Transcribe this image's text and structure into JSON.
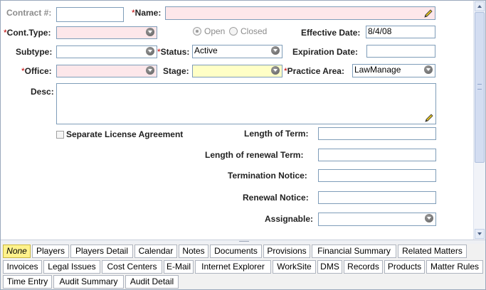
{
  "form": {
    "contract_label": "Contract #:",
    "contract_value": "",
    "name_label": "Name:",
    "name_value": "",
    "conttype_label": "Cont.Type:",
    "conttype_value": "",
    "open_label": "Open",
    "closed_label": "Closed",
    "effective_date_label": "Effective Date:",
    "effective_date_value": "8/4/08",
    "subtype_label": "Subtype:",
    "subtype_value": "",
    "status_label": "Status:",
    "status_value": "Active",
    "expiration_date_label": "Expiration Date:",
    "expiration_date_value": "",
    "office_label": "Office:",
    "office_value": "",
    "stage_label": "Stage:",
    "stage_value": "",
    "practice_area_label": "Practice Area:",
    "practice_area_value": "LawManage",
    "desc_label": "Desc:",
    "desc_value": "",
    "separate_license_label": "Separate License Agreement",
    "length_of_term_label": "Length of Term:",
    "length_of_term_value": "",
    "length_of_renewal_term_label": "Length of renewal Term:",
    "length_of_renewal_term_value": "",
    "termination_notice_label": "Termination Notice:",
    "termination_notice_value": "",
    "renewal_notice_label": "Renewal Notice:",
    "renewal_notice_value": "",
    "assignable_label": "Assignable:",
    "assignable_value": "",
    "required_marker": "*"
  },
  "tabs": {
    "row1": [
      "None",
      "Players",
      "Players Detail",
      "Calendar",
      "Notes",
      "Documents",
      "Provisions",
      "Financial Summary",
      "Related Matters"
    ],
    "row2": [
      "Invoices",
      "Legal Issues",
      "Cost Centers",
      "E-Mail",
      "Internet Explorer",
      "WorkSite",
      "DMS",
      "Records",
      "Products",
      "Matter Rules"
    ],
    "row3": [
      "Time Entry",
      "Audit Summary",
      "Audit Detail"
    ],
    "active": "None"
  },
  "colors": {
    "required_field_bg": "#fde7ea",
    "stage_field_bg": "#ffffc6",
    "active_tab_bg": "#fff28c",
    "required_marker": "#c00000"
  },
  "icons": {
    "combo": "chevron-down-icon",
    "edit": "pencil-icon"
  }
}
